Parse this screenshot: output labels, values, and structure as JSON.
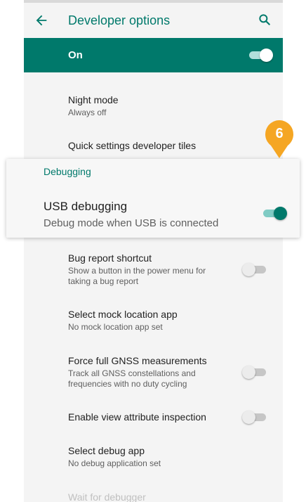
{
  "header": {
    "title": "Developer options",
    "back_icon": "arrow-back-icon",
    "search_icon": "search-icon"
  },
  "master": {
    "label": "On",
    "state": "on"
  },
  "rows": {
    "night_mode": {
      "title": "Night mode",
      "subtitle": "Always off"
    },
    "qs_tiles": {
      "title": "Quick settings developer tiles"
    },
    "bug_report": {
      "title": "Bug report shortcut",
      "subtitle_line1": "Show a button in the power menu for",
      "subtitle_line2": "taking a bug report",
      "state": "off"
    },
    "mock_location": {
      "title": "Select mock location app",
      "subtitle": "No mock location app set"
    },
    "gnss": {
      "title": "Force full GNSS measurements",
      "subtitle_line1": "Track all GNSS constellations and",
      "subtitle_line2": "frequencies with no duty cycling",
      "state": "off"
    },
    "view_attr": {
      "title": "Enable view attribute inspection",
      "state": "off"
    },
    "debug_app": {
      "title": "Select debug app",
      "subtitle": "No debug application set"
    },
    "wait_debugger": {
      "title": "Wait for debugger"
    }
  },
  "highlight": {
    "section_header": "Debugging",
    "title": "USB debugging",
    "subtitle": "Debug mode when USB is connected",
    "state": "on",
    "step_badge": "6"
  },
  "colors": {
    "accent": "#00796b",
    "badge": "#f5a623",
    "background": "#f4f4f4"
  }
}
